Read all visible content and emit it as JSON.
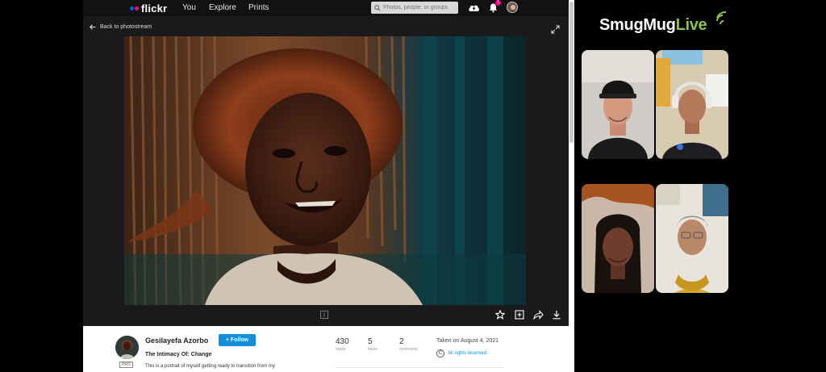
{
  "flickr": {
    "logo": "flickr",
    "nav": [
      "You",
      "Explore",
      "Prints"
    ],
    "search_placeholder": "Photos, people, or groups",
    "notification_count": "1",
    "back_label": "Back to photostream",
    "author": "Gesilayefa Azorbo",
    "pro_badge": "PRO",
    "follow_label": "+ Follow",
    "photo_title": "The Intimacy Of: Change",
    "description": "This is a portrait of myself getting ready to transition from my",
    "stats": [
      {
        "num": "430",
        "label": "views"
      },
      {
        "num": "5",
        "label": "faves"
      },
      {
        "num": "2",
        "label": "comments"
      }
    ],
    "taken": "Taken on August 4, 2021",
    "rights": "All rights reserved",
    "copyright_symbol": "C",
    "colors": {
      "accent": "#128fdc",
      "pink": "#ff0084",
      "blue": "#0063dc"
    }
  },
  "live": {
    "brand_main": "SmugMug",
    "brand_live": "Live",
    "brand_color": "#8dc63f",
    "participants": [
      "participant-1",
      "participant-2",
      "participant-3",
      "participant-4"
    ]
  }
}
